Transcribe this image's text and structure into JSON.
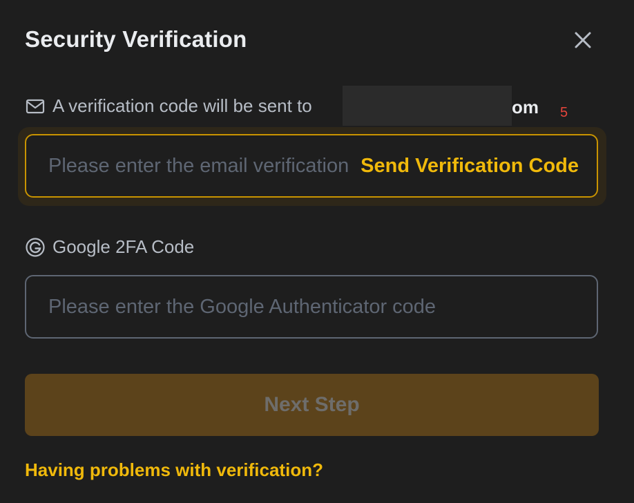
{
  "dialog": {
    "title": "Security Verification"
  },
  "email": {
    "label": "A verification code will be sent to",
    "masked_email_suffix": "om",
    "counter": "5",
    "placeholder": "Please enter the email verification code",
    "send_code_label": "Send Verification Code"
  },
  "google": {
    "label": "Google 2FA Code",
    "placeholder": "Please enter the Google Authenticator code"
  },
  "actions": {
    "next_label": "Next Step",
    "help_link": "Having problems with verification?"
  },
  "icons": {
    "close": "close-icon",
    "email": "envelope-icon",
    "google": "google-icon"
  },
  "colors": {
    "accent": "#f0b90b",
    "background": "#1e1e1e",
    "counter": "#e8453c",
    "next_button_disabled": "#5c431b"
  }
}
